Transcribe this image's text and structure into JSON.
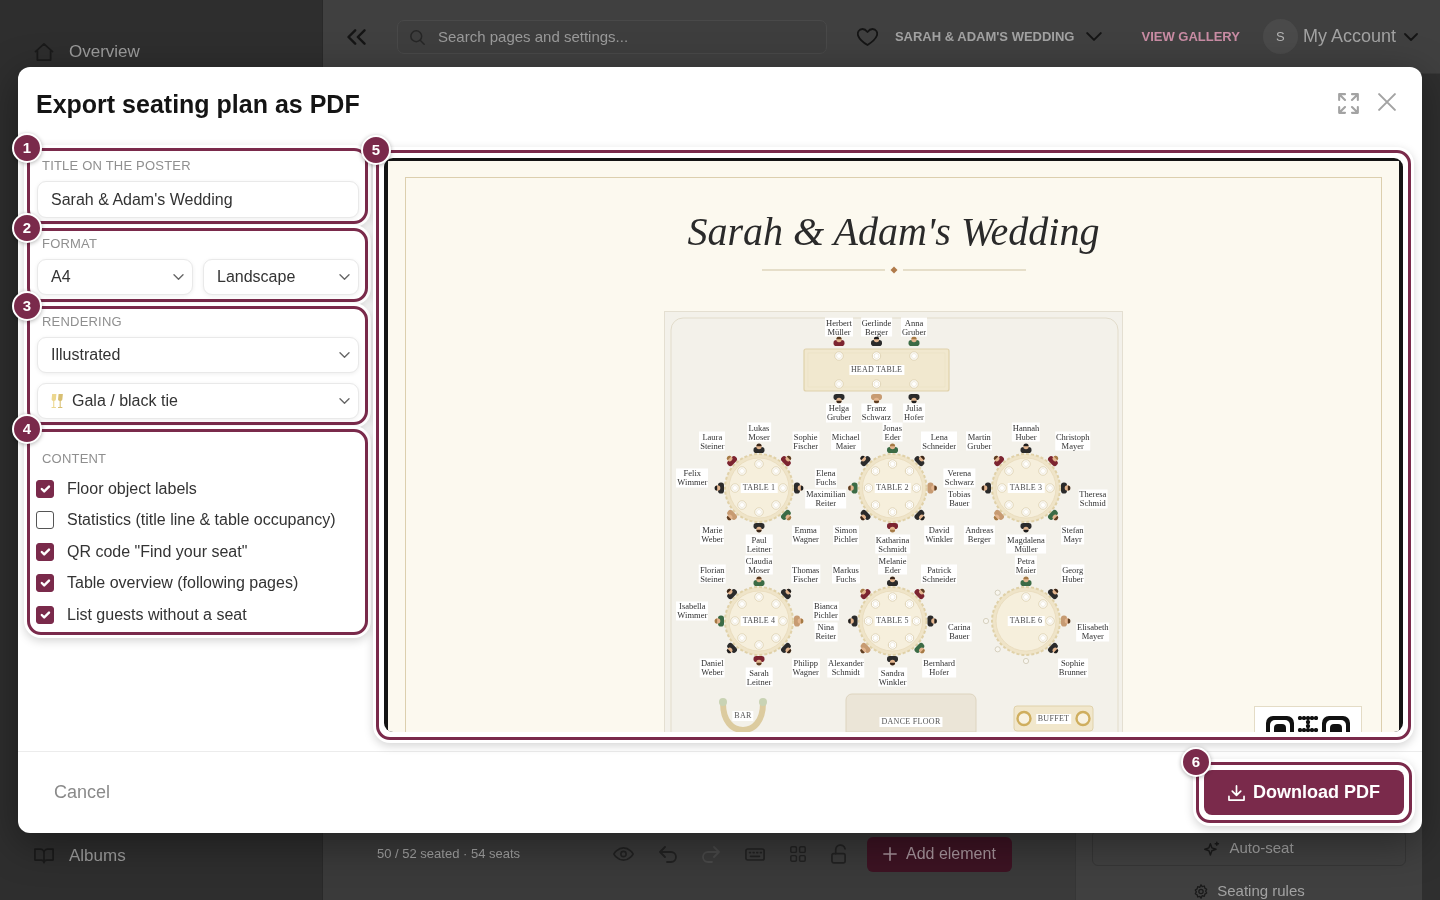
{
  "app": {
    "sidebar": {
      "items": [
        {
          "kind": "home",
          "label": "Overview"
        },
        {
          "kind": "albums",
          "label": "Albums"
        }
      ]
    },
    "topbar": {
      "search": {
        "placeholder": "Search pages and settings..."
      },
      "event": "SARAH & ADAM'S WEDDING",
      "gallery_link": "VIEW GALLERY",
      "avatar": "S",
      "account": "My Account"
    },
    "toolbar": {
      "stats": "50 / 52 seated · 54 seats",
      "tools": [
        {
          "kind": "eye",
          "disabled": false
        },
        {
          "kind": "undo",
          "disabled": false
        },
        {
          "kind": "redo",
          "disabled": true
        },
        {
          "kind": "keyboard",
          "disabled": false
        },
        {
          "kind": "grid",
          "disabled": false
        },
        {
          "kind": "lock",
          "disabled": false
        }
      ],
      "add_button": "Add element"
    },
    "side_panel": {
      "items": [
        {
          "kind": "auto_seat",
          "label": "Auto-seat"
        },
        {
          "kind": "rules",
          "label": "Seating rules"
        }
      ]
    }
  },
  "dialog": {
    "title": "Export seating plan as PDF",
    "settings": [
      {
        "badge": "1",
        "kind": "text",
        "label": "TITLE ON THE POSTER",
        "value": "Sarah & Adam's Wedding"
      },
      {
        "badge": "2",
        "kind": "pair",
        "label": "FORMAT",
        "selects": [
          {
            "kind": "plain",
            "value": "A4"
          },
          {
            "kind": "plain",
            "value": "Landscape"
          }
        ]
      },
      {
        "badge": "3",
        "kind": "stack",
        "label": "RENDERING",
        "selects": [
          {
            "kind": "plain",
            "value": "Illustrated"
          },
          {
            "kind": "theme",
            "value": "Gala / black tie"
          }
        ]
      },
      {
        "badge": "4",
        "kind": "checklist",
        "label": "CONTENT",
        "items": [
          {
            "label": "Floor object labels",
            "checked": true
          },
          {
            "label": "Statistics (title line & table occupancy)",
            "checked": false
          },
          {
            "label": "QR code \"Find your seat\"",
            "checked": true
          },
          {
            "label": "Table overview (following pages)",
            "checked": true
          },
          {
            "label": "List guests without a seat",
            "checked": true
          }
        ]
      }
    ],
    "preview": {
      "badge": "5",
      "poster": {
        "title": "Sarah & Adam's Wedding",
        "head_table": {
          "label": "HEAD TABLE",
          "seats": [
            {
              "occupied": true,
              "guest": "Herbert Müller"
            },
            {
              "occupied": true,
              "guest": "Gerlinde Berger"
            },
            {
              "occupied": true,
              "guest": "Anna Gruber"
            },
            {
              "occupied": true,
              "guest": "Helga Gruber"
            },
            {
              "occupied": true,
              "guest": "Franz Schwarz"
            },
            {
              "occupied": true,
              "guest": "Julia Hofer"
            }
          ]
        },
        "tables": [
          {
            "label": "TABLE 1",
            "seats": [
              {
                "occupied": true,
                "guest": "Lukas Moser"
              },
              {
                "occupied": true,
                "guest": "Sophie Fischer"
              },
              {
                "occupied": true,
                "guest": "Maximilian Reiter"
              },
              {
                "occupied": true,
                "guest": "Emma Wagner"
              },
              {
                "occupied": true,
                "guest": "Paul Leitner"
              },
              {
                "occupied": true,
                "guest": "Marie Weber"
              },
              {
                "occupied": true,
                "guest": "Felix Wimmer"
              },
              {
                "occupied": true,
                "guest": "Laura Steiner"
              }
            ]
          },
          {
            "label": "TABLE 2",
            "seats": [
              {
                "occupied": true,
                "guest": "Jonas Eder"
              },
              {
                "occupied": true,
                "guest": "Lena Schneider"
              },
              {
                "occupied": true,
                "guest": "Tobias Bauer"
              },
              {
                "occupied": true,
                "guest": "David Winkler"
              },
              {
                "occupied": true,
                "guest": "Katharina Schmidt"
              },
              {
                "occupied": true,
                "guest": "Simon Pichler"
              },
              {
                "occupied": true,
                "guest": "Elena Fuchs"
              },
              {
                "occupied": true,
                "guest": "Michael Maier"
              }
            ]
          },
          {
            "label": "TABLE 3",
            "seats": [
              {
                "occupied": true,
                "guest": "Hannah Huber"
              },
              {
                "occupied": true,
                "guest": "Christoph Mayer"
              },
              {
                "occupied": true,
                "guest": "Theresa Schmid"
              },
              {
                "occupied": true,
                "guest": "Stefan Mayr"
              },
              {
                "occupied": true,
                "guest": "Magdalena Müller"
              },
              {
                "occupied": true,
                "guest": "Andreas Berger"
              },
              {
                "occupied": true,
                "guest": "Verena Schwarz"
              },
              {
                "occupied": true,
                "guest": "Martin Gruber"
              }
            ]
          },
          {
            "label": "TABLE 4",
            "seats": [
              {
                "occupied": true,
                "guest": "Claudia Moser"
              },
              {
                "occupied": true,
                "guest": "Thomas Fischer"
              },
              {
                "occupied": true,
                "guest": "Nina Reiter"
              },
              {
                "occupied": true,
                "guest": "Philipp Wagner"
              },
              {
                "occupied": true,
                "guest": "Sarah Leitner"
              },
              {
                "occupied": true,
                "guest": "Daniel Weber"
              },
              {
                "occupied": true,
                "guest": "Isabella Wimmer"
              },
              {
                "occupied": true,
                "guest": "Florian Steiner"
              }
            ]
          },
          {
            "label": "TABLE 5",
            "seats": [
              {
                "occupied": true,
                "guest": "Melanie Eder"
              },
              {
                "occupied": true,
                "guest": "Patrick Schneider"
              },
              {
                "occupied": true,
                "guest": "Carina Bauer"
              },
              {
                "occupied": true,
                "guest": "Bernhard Hofer"
              },
              {
                "occupied": true,
                "guest": "Sandra Winkler"
              },
              {
                "occupied": true,
                "guest": "Alexander Schmidt"
              },
              {
                "occupied": true,
                "guest": "Bianca Pichler"
              },
              {
                "occupied": true,
                "guest": "Markus Fuchs"
              }
            ]
          },
          {
            "label": "TABLE 6",
            "seats": [
              {
                "occupied": true,
                "guest": "Petra Maier"
              },
              {
                "occupied": true,
                "guest": "Georg Huber"
              },
              {
                "occupied": true,
                "guest": "Elisabeth Mayer"
              },
              {
                "occupied": true,
                "guest": "Sophie Brunner"
              },
              {
                "occupied": false
              },
              {
                "occupied": false
              },
              {
                "occupied": false
              },
              {
                "occupied": false
              }
            ]
          }
        ],
        "objects": [
          {
            "kind": "bar",
            "label": "BAR"
          },
          {
            "kind": "dance_floor",
            "label": "DANCE FLOOR"
          },
          {
            "kind": "buffet",
            "label": "BUFFET"
          }
        ]
      }
    },
    "footer": {
      "cancel": "Cancel",
      "download": {
        "badge": "6",
        "label": "Download PDF"
      }
    }
  }
}
